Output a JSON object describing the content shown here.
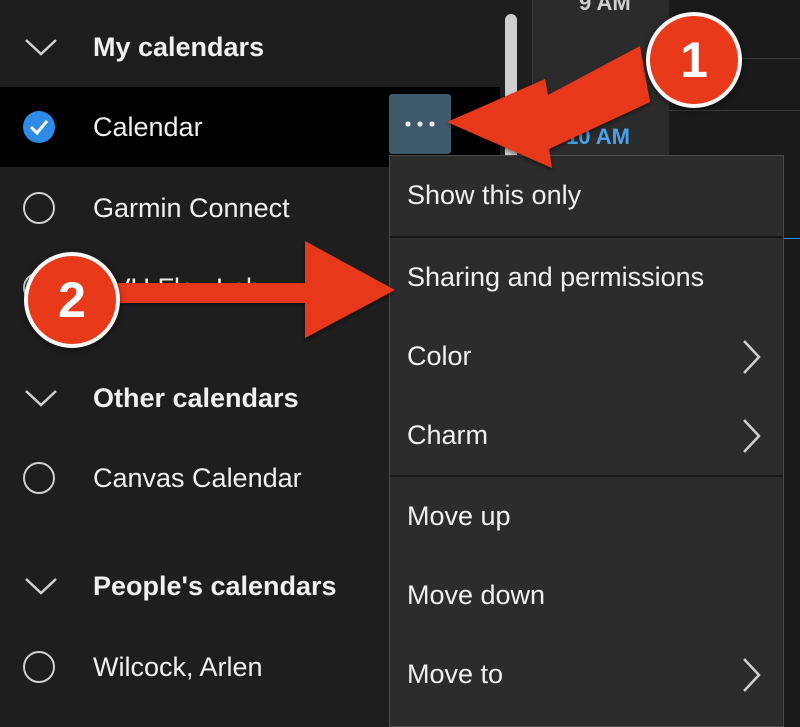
{
  "time_column": {
    "time_9": "9 AM",
    "time_10": "10 AM"
  },
  "sections": {
    "my": {
      "label": "My calendars"
    },
    "other": {
      "label": "Other calendars"
    },
    "people": {
      "label": "People's calendars"
    }
  },
  "calendars": {
    "calendar": {
      "label": "Calendar",
      "checked": true
    },
    "garmin": {
      "label": "Garmin Connect",
      "checked": false
    },
    "flex": {
      "label": "UVU Flex Lab",
      "checked": false
    },
    "canvas": {
      "label": "Canvas Calendar",
      "checked": false
    },
    "wilcock": {
      "label": "Wilcock, Arlen",
      "checked": false
    }
  },
  "more_button": {
    "icon": "more-icon",
    "label": "···"
  },
  "context_menu": {
    "show_this_only": "Show this only",
    "sharing": "Sharing and permissions",
    "color": "Color",
    "charm": "Charm",
    "move_up": "Move up",
    "move_down": "Move down",
    "move_to": "Move to"
  },
  "callouts": {
    "one": "1",
    "two": "2"
  },
  "colors": {
    "background": "#1e1e1e",
    "selected_row": "#000000",
    "check_accent": "#2f8be6",
    "time_accent": "#4aa3e8",
    "menu_bg": "#2c2c2c",
    "callout": "#e8391a"
  }
}
